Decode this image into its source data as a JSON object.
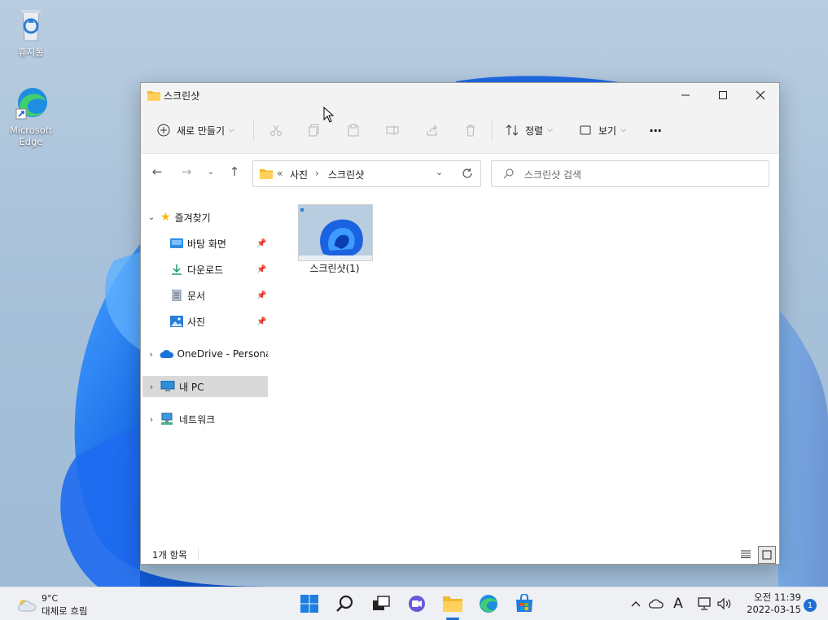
{
  "desktop": {
    "icons": [
      {
        "label": "휴지통"
      },
      {
        "label": "Microsoft\nEdge"
      }
    ]
  },
  "window": {
    "title": "스크린샷",
    "toolbar": {
      "new_label": "새로 만들기",
      "sort_label": "정렬",
      "view_label": "보기",
      "more_label": "···"
    },
    "address": {
      "prefix": "«",
      "crumbs": [
        "사진",
        "스크린샷"
      ],
      "separator": "›"
    },
    "search": {
      "placeholder": "스크린샷 검색"
    },
    "nav": {
      "favorites": "즐겨찾기",
      "items": [
        {
          "label": "바탕 화면"
        },
        {
          "label": "다운로드"
        },
        {
          "label": "문서"
        },
        {
          "label": "사진"
        }
      ],
      "onedrive": "OneDrive - Persona",
      "mypc": "내 PC",
      "network": "네트워크"
    },
    "files": [
      {
        "name": "스크린샷(1)"
      }
    ],
    "status": {
      "count": "1개 항목"
    }
  },
  "taskbar": {
    "weather": {
      "temp": "9°C",
      "desc": "대체로 흐림"
    },
    "ime": "A",
    "clock": {
      "time": "오전 11:39",
      "date": "2022-03-15"
    },
    "notifications": "1"
  }
}
